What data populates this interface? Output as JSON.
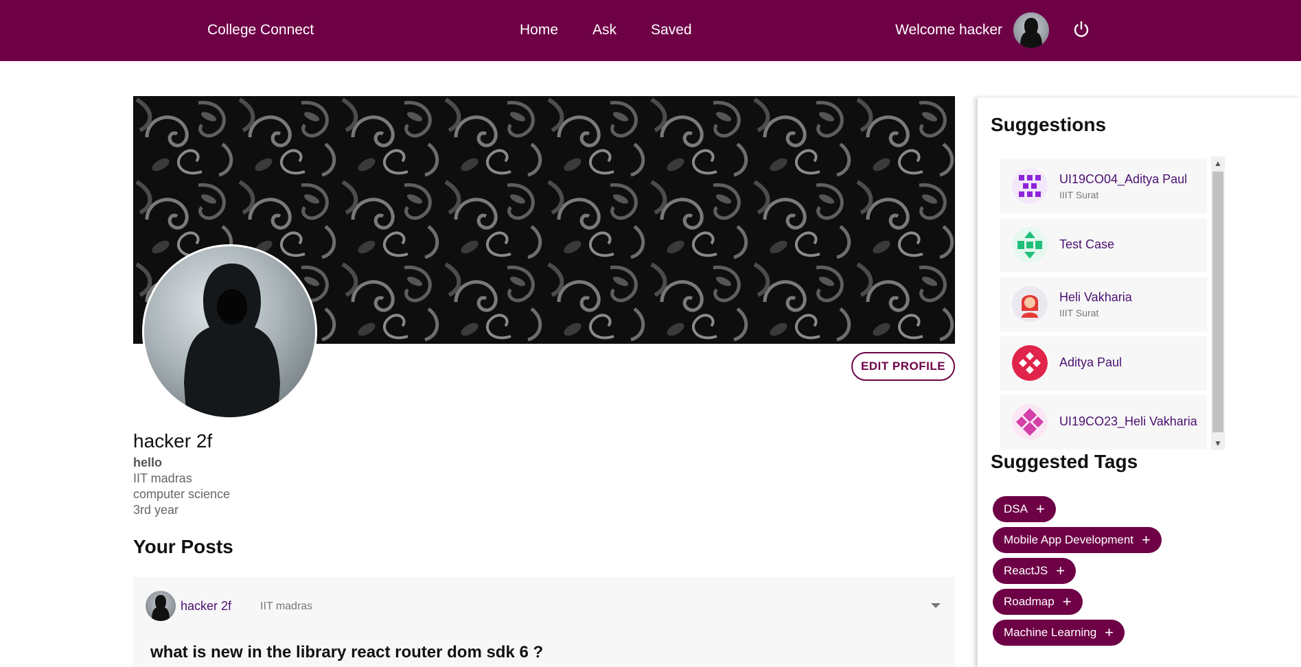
{
  "navbar": {
    "brand": "College Connect",
    "links": [
      "Home",
      "Ask",
      "Saved"
    ],
    "welcome": "Welcome hacker",
    "avatar_icon": "hooded-figure-avatar",
    "power_icon": "power-icon",
    "background": "#6e0046"
  },
  "profile": {
    "edit_label": "EDIT PROFILE",
    "name": "hacker 2f",
    "bio": "hello",
    "college": "IIT madras",
    "branch": "computer science",
    "year": "3rd year"
  },
  "posts": {
    "section_title": "Your Posts",
    "items": [
      {
        "author": "hacker 2f",
        "college": "IIT madras",
        "title": "what is new in the library react router dom sdk 6 ?"
      }
    ]
  },
  "sidebar": {
    "suggestions_title": "Suggestions",
    "suggestions": [
      {
        "name": "UI19CO04_Aditya Paul",
        "sub": "IIIT Surat",
        "color": "#8e24d9"
      },
      {
        "name": "Test Case",
        "sub": "",
        "color": "#1fbf7a"
      },
      {
        "name": "Heli Vakharia",
        "sub": "IIIT Surat",
        "color": "#e53935"
      },
      {
        "name": "Aditya Paul",
        "sub": "",
        "color": "#e0244a"
      },
      {
        "name": "UI19CO23_Heli Vakharia",
        "sub": "",
        "color": "#d43fa8"
      }
    ],
    "tags_title": "Suggested Tags",
    "tags": [
      "DSA",
      "Mobile App Development",
      "ReactJS",
      "Roadmap",
      "Machine Learning"
    ]
  },
  "colors": {
    "accent": "#6e0046",
    "link": "#4b1070"
  }
}
